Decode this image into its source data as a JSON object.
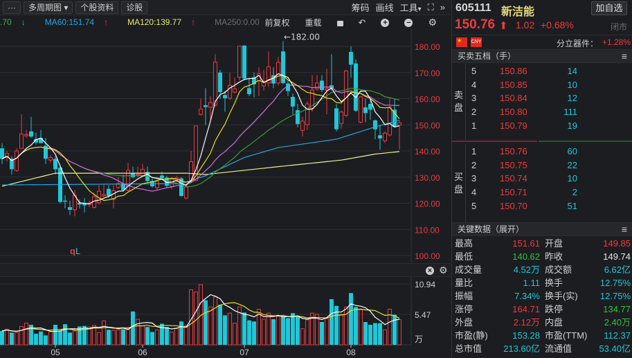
{
  "toolbar": {
    "more": "···",
    "multi_period": "多周期图",
    "multi_period_caret": "▾",
    "stock_info": "个股资料",
    "diagnose": "诊股",
    "chips": "筹码",
    "draw": "画线",
    "tools": "工具",
    "tools_caret": "▾",
    "expand": "⛶",
    "collapse": "»"
  },
  "ma_legend": {
    "ma30_partial": ".70",
    "ma30_arrow": "↓",
    "ma60": "MA60:151.74",
    "ma60_arrow": "↑",
    "ma120": "MA120:139.77",
    "ma120_arrow": "↑",
    "ma250": "MA250:0.00",
    "adjust": "前复权",
    "reload": "重载"
  },
  "colors": {
    "up": "#ee3b3f",
    "down": "#1ec8d8",
    "ma5": "#ffffff",
    "ma10": "#e8e020",
    "ma20": "#d070e0",
    "ma30": "#3c9a3c",
    "ma60": "#22a8e0",
    "ma120": "#f0f090",
    "vol_ma5": "#ffffff",
    "vol_ma10": "#e8e020"
  },
  "chart_data": {
    "type": "candlestick",
    "y_ticks": [
      "180.00",
      "170.00",
      "160.00",
      "150.00",
      "140.00",
      "130.00",
      "120.00",
      "110.00",
      "100.00"
    ],
    "y_tick_values": [
      180,
      170,
      160,
      150,
      140,
      130,
      120,
      110,
      100
    ],
    "ylim": [
      100,
      180
    ],
    "high_annotation": "←182.00",
    "event_marker": {
      "a": "q",
      "b": "L"
    },
    "x_labels": [
      {
        "label": "05",
        "index": 11
      },
      {
        "label": "06",
        "index": 29
      },
      {
        "label": "07",
        "index": 50
      },
      {
        "label": "08",
        "index": 72
      }
    ],
    "ohlc": [
      [
        141,
        143,
        135,
        137
      ],
      [
        137.5,
        140,
        136,
        139
      ],
      [
        137,
        138,
        131,
        133
      ],
      [
        132.5,
        141,
        132,
        140
      ],
      [
        141,
        154,
        141,
        146.5
      ],
      [
        145.8,
        148,
        145,
        146.3
      ],
      [
        147.5,
        153,
        145,
        145.5
      ],
      [
        144.6,
        147,
        142.5,
        143.2
      ],
      [
        145,
        148,
        143,
        143
      ],
      [
        142,
        145,
        135,
        137
      ],
      [
        136.5,
        138.5,
        135.5,
        137.5
      ],
      [
        137,
        138,
        131,
        133
      ],
      [
        133.6,
        134,
        120,
        120.5
      ],
      [
        121,
        123,
        118,
        120.6
      ],
      [
        118.5,
        121,
        115.5,
        117.5
      ],
      [
        117.5,
        125,
        115,
        123
      ],
      [
        120.2,
        121.5,
        118,
        119.5
      ],
      [
        120,
        122,
        116.5,
        119.2
      ],
      [
        119.5,
        121,
        118.5,
        120
      ],
      [
        118.4,
        124,
        118,
        122.5
      ],
      [
        120.2,
        127,
        119.5,
        124.6
      ],
      [
        122.8,
        127,
        122,
        123.3
      ],
      [
        125.5,
        127,
        122,
        122.8
      ],
      [
        121.5,
        127,
        118,
        124.8
      ],
      [
        126,
        130,
        125.5,
        127.5
      ],
      [
        127.5,
        131,
        124.5,
        125
      ],
      [
        125,
        135.5,
        124.5,
        132.6
      ],
      [
        131.6,
        134,
        129.5,
        130
      ],
      [
        130.8,
        134,
        130,
        131.2
      ],
      [
        130.4,
        135,
        130,
        133
      ],
      [
        132,
        134,
        128,
        128.5
      ],
      [
        128.5,
        129.5,
        126,
        126.5
      ],
      [
        126,
        129,
        125,
        128.3
      ],
      [
        130.6,
        132,
        129,
        129.6
      ],
      [
        129.8,
        130.5,
        126,
        126.7
      ],
      [
        126.5,
        130,
        125.5,
        129.2
      ],
      [
        128.8,
        130.5,
        128,
        129.6
      ],
      [
        129.5,
        130,
        122.5,
        122.8
      ],
      [
        122,
        127,
        121.5,
        126.2
      ],
      [
        128.7,
        140,
        128,
        135.9
      ],
      [
        128.7,
        149.6,
        128.5,
        149.6
      ],
      [
        154,
        160,
        153.5,
        156
      ],
      [
        157.5,
        164,
        150,
        156.8
      ],
      [
        156.7,
        161,
        152,
        158.5
      ],
      [
        157.5,
        177,
        157,
        174
      ],
      [
        170,
        171,
        160,
        162.5
      ],
      [
        161.4,
        163,
        155,
        160.2
      ],
      [
        160.2,
        170,
        159.5,
        165.1
      ],
      [
        162.5,
        168,
        162,
        163.8
      ],
      [
        168.2,
        180.1,
        167,
        180.1
      ],
      [
        180.3,
        180.5,
        167,
        167.7
      ],
      [
        164,
        168,
        161,
        161.7
      ],
      [
        168.2,
        170,
        160.5,
        165.5
      ],
      [
        166.9,
        172,
        161,
        169.5
      ],
      [
        164.9,
        171,
        163,
        166.4
      ],
      [
        166,
        178,
        164.5,
        172.2
      ],
      [
        169,
        172,
        164,
        165.8
      ],
      [
        166,
        176,
        165,
        173.9
      ],
      [
        178.1,
        182,
        165.5,
        166
      ],
      [
        165.8,
        167,
        161,
        162.9
      ],
      [
        160.7,
        162,
        154,
        157
      ],
      [
        155.6,
        158,
        149,
        150.3
      ],
      [
        147.9,
        153,
        145.5,
        151.4
      ],
      [
        150.1,
        159,
        148,
        158
      ],
      [
        156.3,
        169,
        155,
        163.3
      ],
      [
        163.8,
        169,
        163,
        166
      ],
      [
        166.9,
        169,
        162.5,
        163.3
      ],
      [
        163.3,
        171.5,
        154,
        163.8
      ],
      [
        165.1,
        177,
        163,
        164
      ],
      [
        156.3,
        158,
        147.5,
        148.3
      ],
      [
        150.5,
        155.5,
        148.5,
        154.9
      ],
      [
        153.6,
        171,
        153,
        170.6
      ],
      [
        177.9,
        180,
        168,
        173
      ],
      [
        173.5,
        175,
        155,
        155.4
      ],
      [
        151,
        161,
        150.5,
        160.7
      ],
      [
        156.7,
        160,
        151,
        154.5
      ],
      [
        158,
        160,
        152,
        155.8
      ],
      [
        151.7,
        152,
        144.5,
        148.3
      ],
      [
        146,
        150,
        140.5,
        144.8
      ],
      [
        143.9,
        147.5,
        143,
        146.8
      ],
      [
        146.1,
        160,
        145.5,
        156.7
      ],
      [
        155.8,
        160,
        149,
        149.2
      ],
      [
        149.85,
        151.61,
        140.62,
        150.76
      ]
    ],
    "ma60_points": [
      [
        0,
        127
      ],
      [
        37,
        127.5
      ],
      [
        42,
        130.5
      ],
      [
        50,
        137.5
      ],
      [
        57,
        141.3
      ],
      [
        69,
        144.5
      ],
      [
        77,
        149.2
      ],
      [
        82,
        151.74
      ]
    ],
    "ma120_points": [
      [
        0,
        126.5
      ],
      [
        11,
        131.5
      ],
      [
        38,
        131.5
      ],
      [
        42,
        131
      ],
      [
        57,
        134
      ],
      [
        70,
        136.5
      ],
      [
        77,
        138.8
      ],
      [
        82,
        139.77
      ]
    ],
    "volume": {
      "unit": "万",
      "y_ticks": [
        "10.94",
        "5.47"
      ],
      "ylim": [
        0,
        10.94
      ],
      "values": [
        2.5,
        2.8,
        2.2,
        2.2,
        3.3,
        3.9,
        3.6,
        2.0,
        2.4,
        1.7,
        2.4,
        3.6,
        2.5,
        3.7,
        2.2,
        2.5,
        3.3,
        3.4,
        3.2,
        3.5,
        2.2,
        4.3,
        2.7,
        2.6,
        2.7,
        2.8,
        2.9,
        6.0,
        4.6,
        3.4,
        3.2,
        2.3,
        2.7,
        3.8,
        3.2,
        2.3,
        2.9,
        4.2,
        3.4,
        9.9,
        9.5,
        10.8,
        8.0,
        6.8,
        8.6,
        7.2,
        5.3,
        5.7,
        3.9,
        6.8,
        5.8,
        4.4,
        4.2,
        6.4,
        4.6,
        5.7,
        4.6,
        5.2,
        5.1,
        4.8,
        5.7,
        5.2,
        2.9,
        4.5,
        5.7,
        5.5,
        4.1,
        4.7,
        8.2,
        7.0,
        5.5,
        6.8,
        9.3,
        6.8,
        6.3,
        4.1,
        3.6,
        3.9,
        3.9,
        2.7,
        6.4,
        5.4,
        4.52
      ]
    }
  },
  "quote": {
    "code": "605111",
    "name": "新洁能",
    "add_watch": "加自选",
    "price": "150.76",
    "arrow": "⬆",
    "change": "1.02",
    "change_pct": "+0.68%",
    "status": "闭市",
    "flag_cn": "★",
    "currency": "CNY",
    "sector_label": "分立器件：",
    "sector_change": "+1.28%"
  },
  "orderbook": {
    "title": "买卖五档（手）",
    "menu": "≡",
    "sell_label": "卖盘",
    "buy_label": "买盘",
    "sell": [
      {
        "level": "5",
        "price": "150.86",
        "qty": "14"
      },
      {
        "level": "4",
        "price": "150.85",
        "qty": "10"
      },
      {
        "level": "3",
        "price": "150.84",
        "qty": "12"
      },
      {
        "level": "2",
        "price": "150.80",
        "qty": "111"
      },
      {
        "level": "1",
        "price": "150.79",
        "qty": "19"
      }
    ],
    "buy": [
      {
        "level": "1",
        "price": "150.76",
        "qty": "60"
      },
      {
        "level": "2",
        "price": "150.75",
        "qty": "22"
      },
      {
        "level": "3",
        "price": "150.74",
        "qty": "10"
      },
      {
        "level": "4",
        "price": "150.71",
        "qty": "2"
      },
      {
        "level": "5",
        "price": "150.70",
        "qty": "51"
      }
    ]
  },
  "keydata": {
    "title": "关键数据（展开）",
    "menu": "≡",
    "rows": [
      {
        "k1": "最高",
        "v1": "151.61",
        "c1": "red",
        "k2": "开盘",
        "v2": "149.85",
        "c2": "red"
      },
      {
        "k1": "最低",
        "v1": "140.62",
        "c1": "grn",
        "k2": "昨收",
        "v2": "149.74",
        "c2": "wht"
      },
      {
        "k1": "成交量",
        "v1": "4.52万",
        "c1": "cyn",
        "k2": "成交额",
        "v2": "6.62亿",
        "c2": "cyn"
      },
      {
        "k1": "量比",
        "v1": "1.11",
        "c1": "cyn",
        "k2": "换手",
        "v2": "12.75%",
        "c2": "cyn"
      },
      {
        "k1": "振幅",
        "v1": "7.34%",
        "c1": "cyn",
        "k2": "换手(实)",
        "v2": "12.75%",
        "c2": "cyn"
      },
      {
        "k1": "涨停",
        "v1": "164.71",
        "c1": "red",
        "k2": "跌停",
        "v2": "134.77",
        "c2": "grn"
      },
      {
        "k1": "外盘",
        "v1": "2.12万",
        "c1": "red",
        "k2": "内盘",
        "v2": "2.40万",
        "c2": "grn"
      },
      {
        "k1": "市盈(静)",
        "v1": "153.28",
        "c1": "cyn",
        "k2": "市盈(TTM)",
        "v2": "112.37",
        "c2": "cyn"
      },
      {
        "k1": "总市值",
        "v1": "213.60亿",
        "c1": "cyn",
        "k2": "流通值",
        "v2": "53.40亿",
        "c2": "cyn"
      }
    ]
  }
}
